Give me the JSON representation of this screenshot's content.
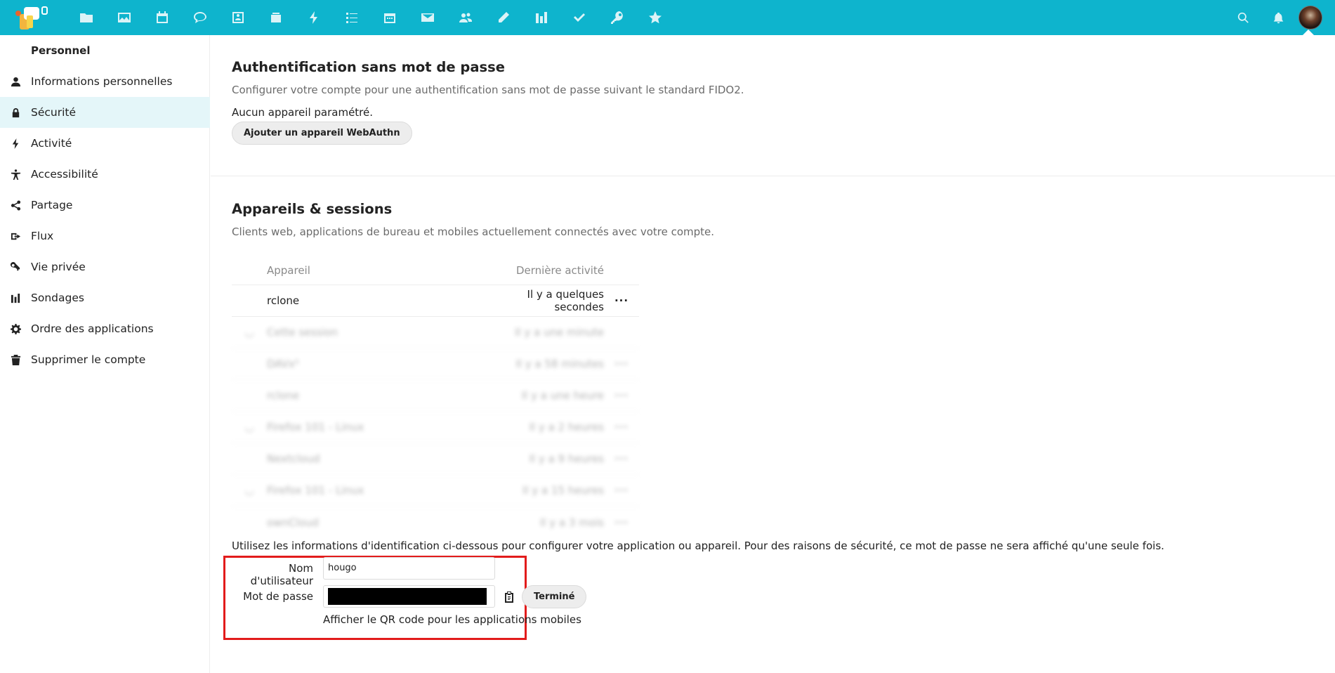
{
  "topbar": {
    "apps": [
      "folder-icon",
      "image-icon",
      "calendar-icon",
      "talk-icon",
      "contacts-icon",
      "deck-icon",
      "activity-icon",
      "tasks-icon",
      "calendar2-icon",
      "mail-icon",
      "circles-icon",
      "notes-icon",
      "polls-icon",
      "check-icon",
      "passwords-icon",
      "star-icon"
    ],
    "right": [
      "search-icon",
      "bell-icon"
    ]
  },
  "sidebar": {
    "caption": "Personnel",
    "items": [
      {
        "label": "Informations personnelles",
        "icon": "user-icon",
        "active": false
      },
      {
        "label": "Sécurité",
        "icon": "lock-icon",
        "active": true
      },
      {
        "label": "Activité",
        "icon": "activity-icon",
        "active": false
      },
      {
        "label": "Accessibilité",
        "icon": "accessibility-icon",
        "active": false
      },
      {
        "label": "Partage",
        "icon": "share-icon",
        "active": false
      },
      {
        "label": "Flux",
        "icon": "flux-icon",
        "active": false
      },
      {
        "label": "Vie privée",
        "icon": "key-icon",
        "active": false
      },
      {
        "label": "Sondages",
        "icon": "polls-icon",
        "active": false
      },
      {
        "label": "Ordre des applications",
        "icon": "gear-icon",
        "active": false
      },
      {
        "label": "Supprimer le compte",
        "icon": "trash-icon",
        "active": false
      }
    ]
  },
  "passwordless": {
    "title": "Authentification sans mot de passe",
    "description": "Configurer votre compte pour une authentification sans mot de passe suivant le standard FIDO2.",
    "status": "Aucun appareil paramétré.",
    "add_button": "Ajouter un appareil WebAuthn"
  },
  "sessions": {
    "title": "Appareils & sessions",
    "description": "Clients web, applications de bureau et mobiles actuellement connectés avec votre compte.",
    "col_device": "Appareil",
    "col_activity": "Dernière activité",
    "rows": [
      {
        "name": "rclone",
        "activity": "Il y a quelques secondes",
        "menu": "···",
        "blurred": false
      },
      {
        "name": "Cette session",
        "activity": "Il y a une minute",
        "menu": "",
        "blurred": true
      },
      {
        "name": "DAVx⁵",
        "activity": "Il y a 58 minutes",
        "menu": "···",
        "blurred": true
      },
      {
        "name": "rclone",
        "activity": "Il y a une heure",
        "menu": "···",
        "blurred": true
      },
      {
        "name": "Firefox 101 - Linux",
        "activity": "Il y a 2 heures",
        "menu": "···",
        "blurred": true
      },
      {
        "name": "Nextcloud",
        "activity": "Il y a 9 heures",
        "menu": "···",
        "blurred": true
      },
      {
        "name": "Firefox 101 - Linux",
        "activity": "Il y a 15 heures",
        "menu": "···",
        "blurred": true
      },
      {
        "name": "ownCloud",
        "activity": "Il y a 3 mois",
        "menu": "···",
        "blurred": true
      }
    ]
  },
  "credentials": {
    "message": "Utilisez les informations d'identification ci-dessous pour configurer votre application ou appareil. Pour des raisons de sécurité, ce mot de passe ne sera affiché qu'une seule fois.",
    "username_label": "Nom d'utilisateur",
    "username_value": "hougo",
    "password_label": "Mot de passe",
    "done_button": "Terminé",
    "qr_link": "Afficher le QR code pour les applications mobiles",
    "highlight_color": "#e21b1b"
  },
  "colors": {
    "accent": "#0eb4cd",
    "active_bg": "#e4f6f9"
  }
}
